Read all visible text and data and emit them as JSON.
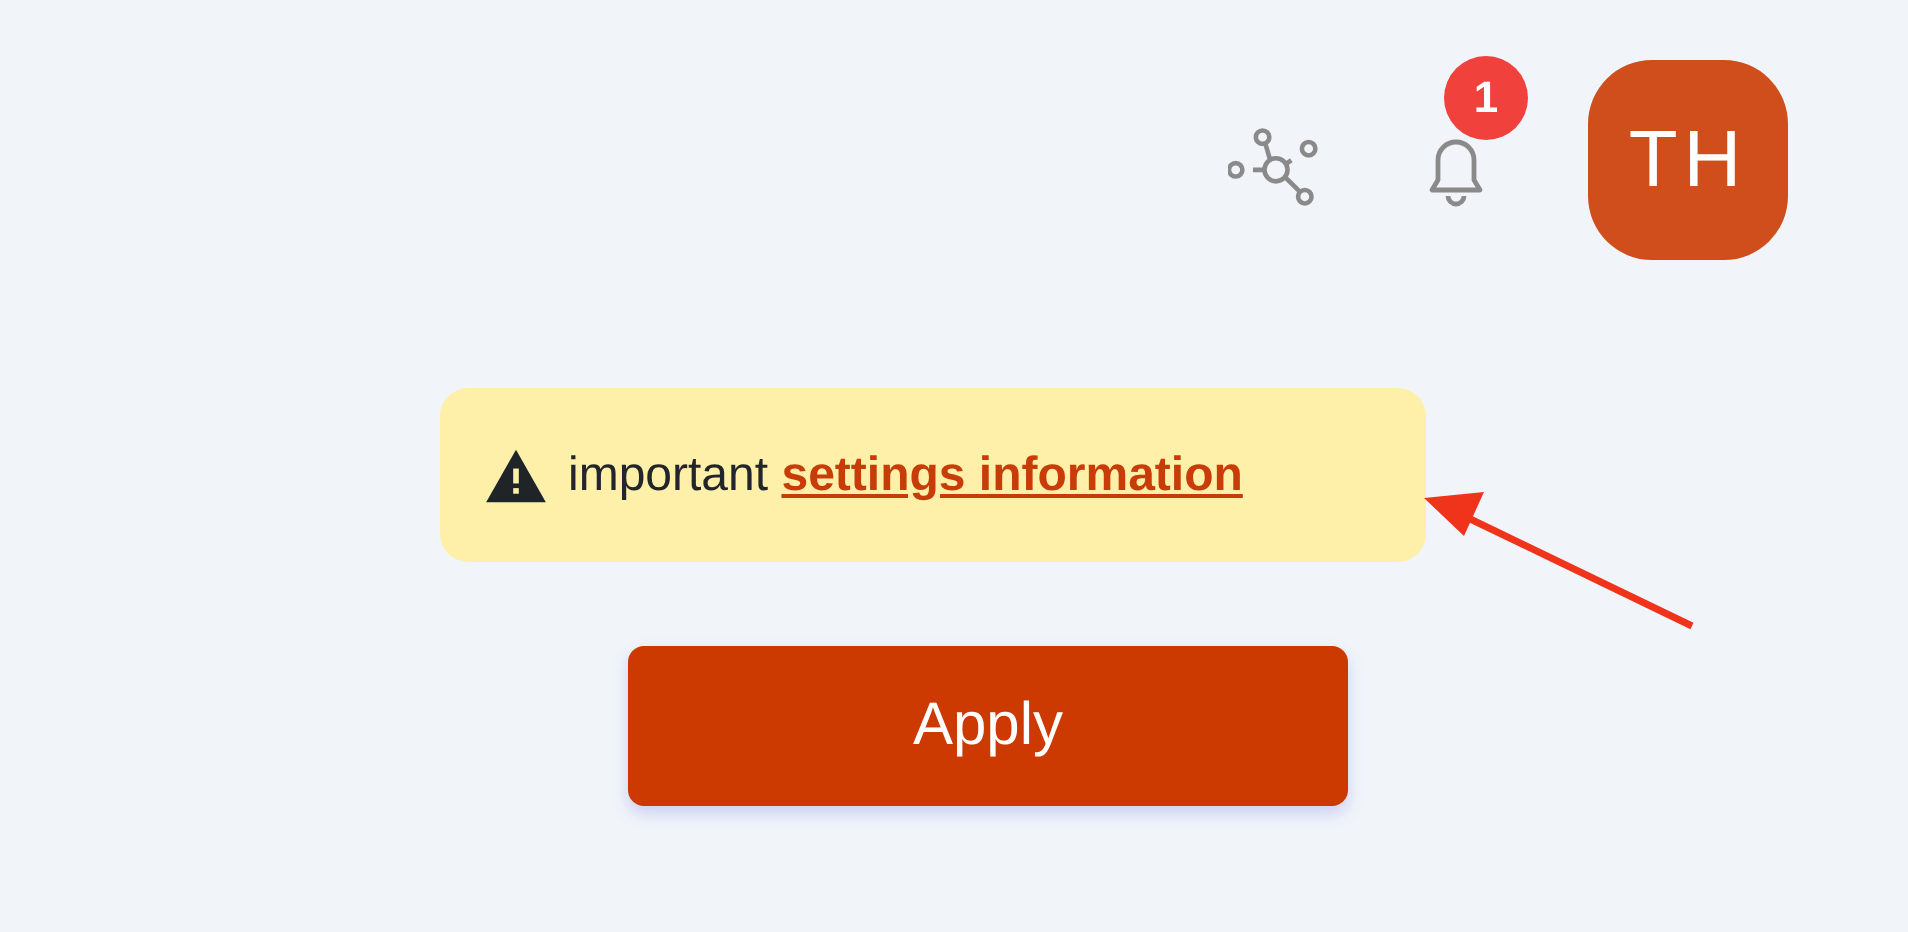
{
  "header": {
    "notifications": {
      "count": "1"
    },
    "avatar": {
      "initials": "TH"
    }
  },
  "notice": {
    "text": "important",
    "link": "settings information"
  },
  "apply_button": {
    "label": "Apply"
  }
}
